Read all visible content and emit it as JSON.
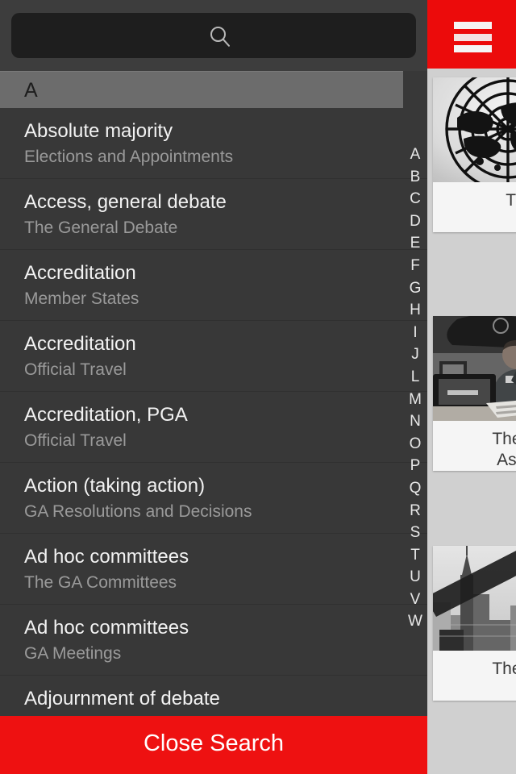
{
  "app": {
    "accent_red": "#ee1111",
    "header_red": "#f60c0c",
    "drawer_bg": "#383838",
    "panel_bg": "#d9d9d9"
  },
  "header": {
    "menu_icon": "hamburger-menu-icon"
  },
  "search": {
    "value": "",
    "placeholder": "",
    "icon": "search-icon"
  },
  "section": {
    "letter": "A"
  },
  "results": [
    {
      "title": "Absolute majority",
      "subtitle": "Elections and Appointments"
    },
    {
      "title": "Access, general debate",
      "subtitle": "The General Debate"
    },
    {
      "title": "Accreditation",
      "subtitle": "Member States"
    },
    {
      "title": "Accreditation",
      "subtitle": "Official Travel"
    },
    {
      "title": "Accreditation, PGA",
      "subtitle": "Official Travel"
    },
    {
      "title": "Action (taking action)",
      "subtitle": "GA Resolutions and Decisions"
    },
    {
      "title": "Ad hoc committees",
      "subtitle": "The GA Committees"
    },
    {
      "title": "Ad hoc committees",
      "subtitle": "GA Meetings"
    },
    {
      "title": "Adjournment of debate",
      "subtitle": ""
    }
  ],
  "index": [
    "A",
    "B",
    "C",
    "D",
    "E",
    "F",
    "G",
    "H",
    "I",
    "J",
    "L",
    "M",
    "N",
    "O",
    "P",
    "Q",
    "R",
    "S",
    "T",
    "U",
    "V",
    "W"
  ],
  "footer": {
    "close_label": "Close Search"
  },
  "background_cards": [
    {
      "title": "Th",
      "image": "un-globe-emblem-photo"
    },
    {
      "title": "The G\nAsse",
      "image": "person-at-desk-photo"
    },
    {
      "title": "The O",
      "image": "city-skyline-photo"
    }
  ]
}
